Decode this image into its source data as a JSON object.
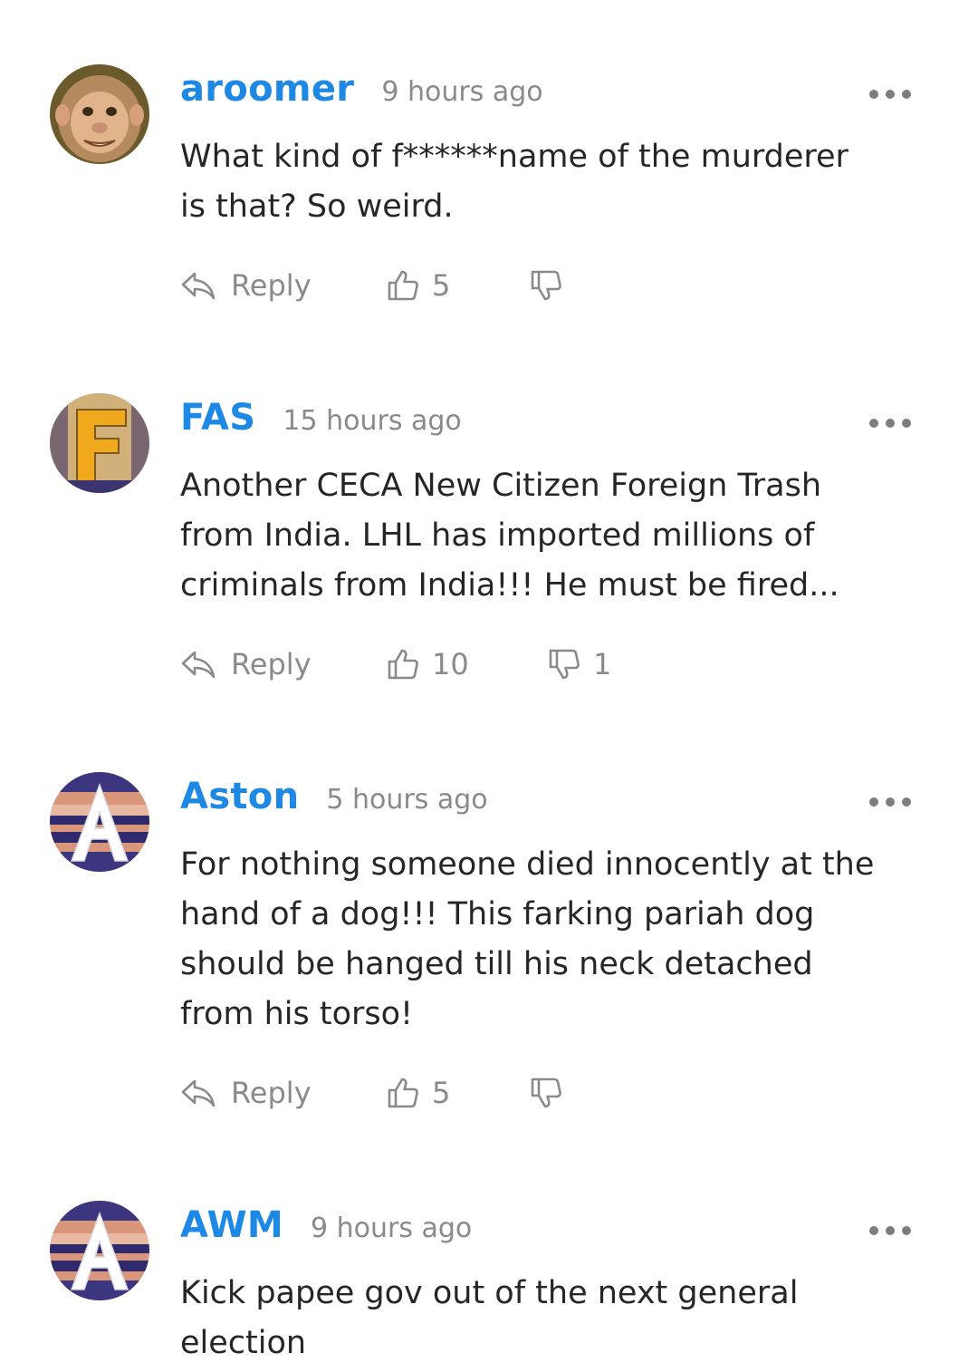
{
  "colors": {
    "username": "#1e88e5",
    "muted": "#8a8a8a",
    "text": "#262626"
  },
  "comments": [
    {
      "avatar": "monkey-avatar",
      "username": "aroomer",
      "time": "9 hours ago",
      "text": "What kind of f******name of the murderer\nis that? So weird.",
      "reply_label": "Reply",
      "likes": "5",
      "dislikes": ""
    },
    {
      "avatar": "letter-f-avatar",
      "username": "FAS",
      "time": "15 hours ago",
      "text": "Another CECA New Citizen Foreign Trash\nfrom India. LHL has imported millions of\ncriminals from India!!! He must be fired...",
      "reply_label": "Reply",
      "likes": "10",
      "dislikes": "1"
    },
    {
      "avatar": "letter-a-avatar",
      "username": "Aston",
      "time": "5 hours ago",
      "text": "For nothing someone died innocently at the\nhand of a dog!!! This farking pariah dog\nshould be hanged till his neck detached\nfrom his torso!",
      "reply_label": "Reply",
      "likes": "5",
      "dislikes": ""
    },
    {
      "avatar": "letter-a-avatar",
      "username": "AWM",
      "time": "9 hours ago",
      "text": "Kick papee gov out of the next general\nelection"
    }
  ]
}
